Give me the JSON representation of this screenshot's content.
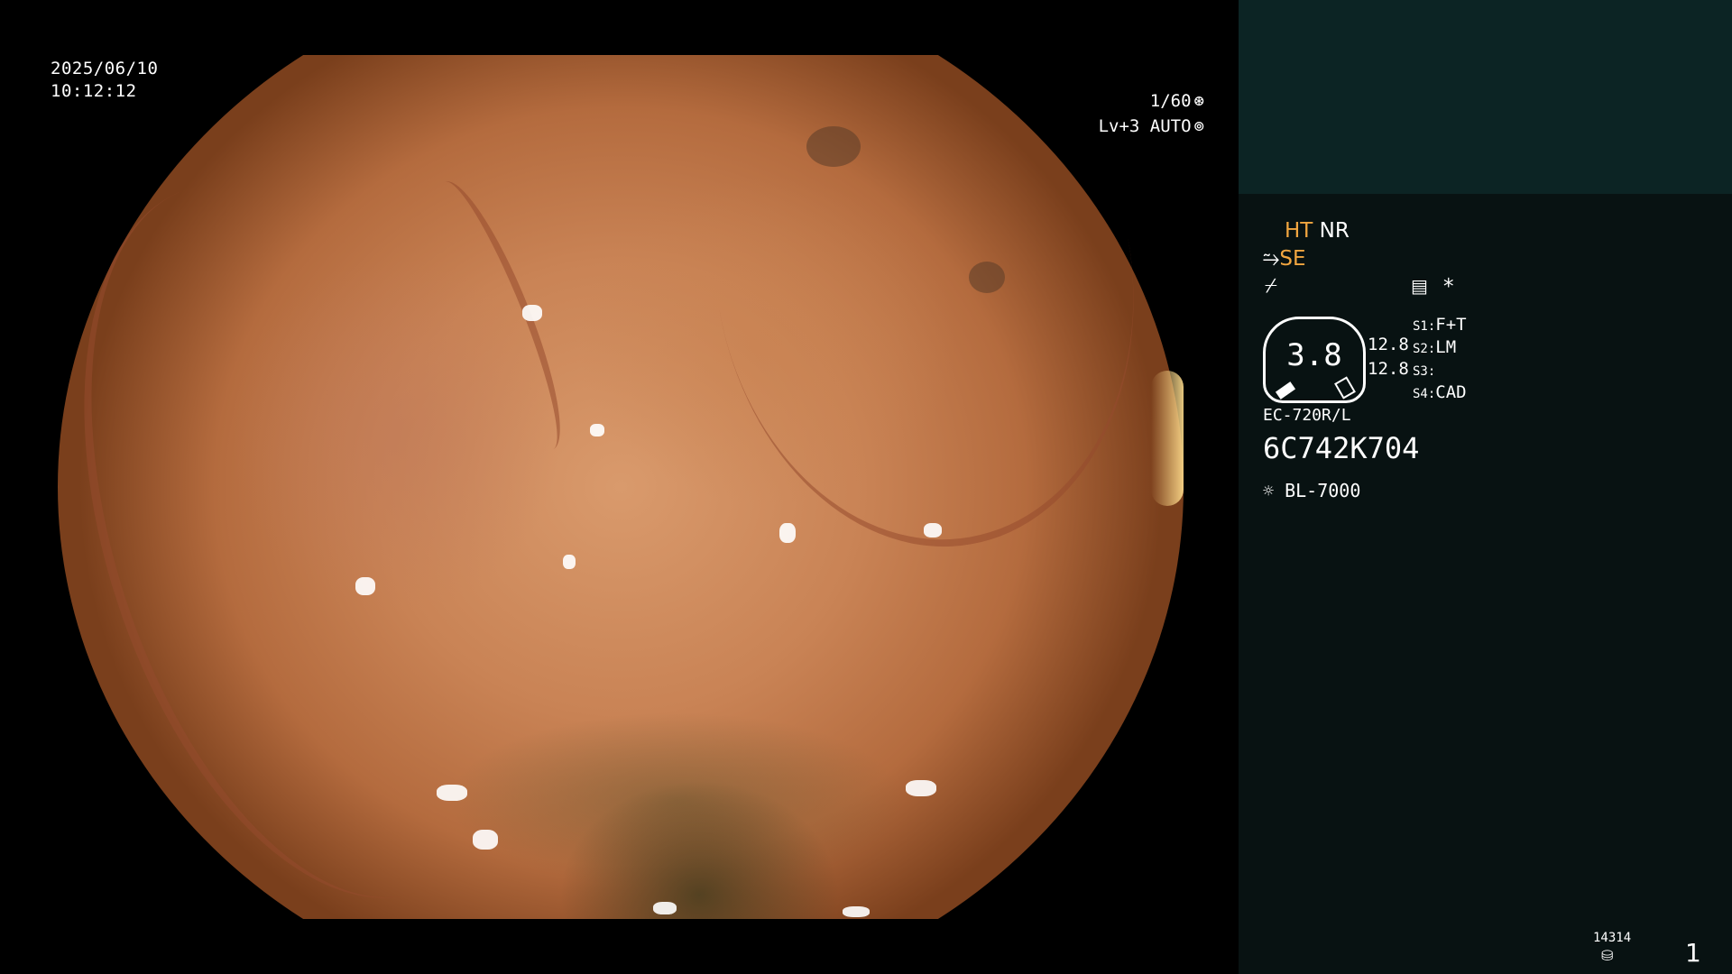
{
  "overlay": {
    "date": "2025/06/10",
    "time": "10:12:12",
    "shutter": "1/60",
    "shutter_icon": "aperture-icon",
    "level": "Lv+3",
    "mode": "AUTO",
    "mode_icon": "auto-iris-icon"
  },
  "panel": {
    "ht": "HT",
    "nr": "NR",
    "se": "SE",
    "gauge_value": "3.8",
    "gauge_side_top": "12.8",
    "gauge_side_bottom": "12.8",
    "switches": [
      {
        "key": "S1:",
        "value": "F+T"
      },
      {
        "key": "S2:",
        "value": "LM"
      },
      {
        "key": "S3:",
        "value": ""
      },
      {
        "key": "S4:",
        "value": "CAD"
      }
    ],
    "asterisk": "*",
    "scope_model": "EC-720R/L",
    "serial": "6C742K704",
    "light_source": "BL-7000",
    "counter": "14314",
    "frame_number": "1"
  },
  "colors": {
    "accent_orange": "#f2a640",
    "panel_bg": "#081212",
    "panel_top_bg": "#0c2424"
  }
}
